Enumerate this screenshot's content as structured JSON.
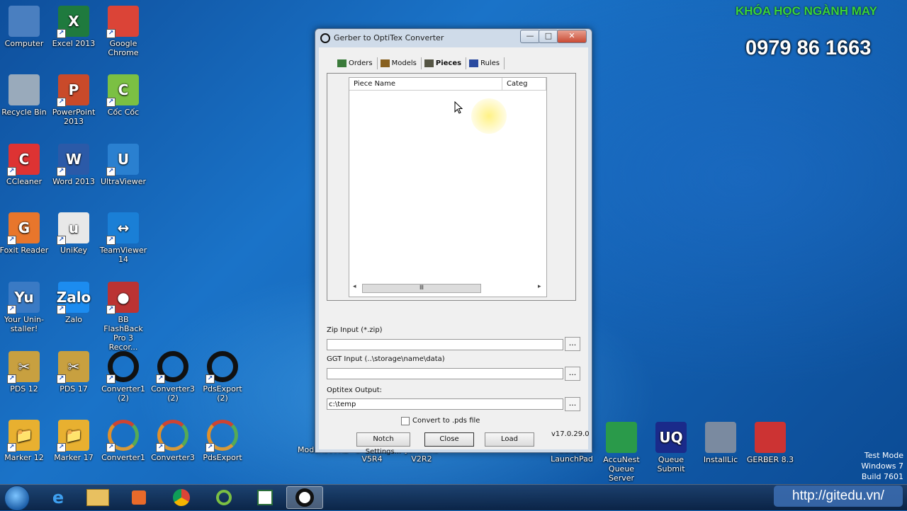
{
  "desktop_icons": [
    {
      "label": "Computer",
      "color": "#4a7fc0",
      "glyph": "monitor-icon"
    },
    {
      "label": "Excel 2013",
      "color": "#1f7a3e",
      "glyph": "X"
    },
    {
      "label": "Google Chrome",
      "color": "#db4437",
      "glyph": "chrome-icon"
    },
    {
      "label": "Recycle Bin",
      "color": "#9ab",
      "glyph": "bin-icon"
    },
    {
      "label": "PowerPoint 2013",
      "color": "#c94a2a",
      "glyph": "P"
    },
    {
      "label": "Cốc Cốc",
      "color": "#7bc043",
      "glyph": "C"
    },
    {
      "label": "CCleaner",
      "color": "#d33",
      "glyph": "C"
    },
    {
      "label": "Word 2013",
      "color": "#2b5aa8",
      "glyph": "W"
    },
    {
      "label": "UltraViewer",
      "color": "#2a80d0",
      "glyph": "U"
    },
    {
      "label": "Foxit Reader",
      "color": "#e8762c",
      "glyph": "G"
    },
    {
      "label": "UniKey",
      "color": "#e8e8e8",
      "glyph": "u"
    },
    {
      "label": "TeamViewer 14",
      "color": "#1a7fd6",
      "glyph": "↔"
    },
    {
      "label": "Your Unin-staller!",
      "color": "#3a7ac4",
      "glyph": "Yu"
    },
    {
      "label": "Zalo",
      "color": "#1c8cf0",
      "glyph": "Zalo"
    },
    {
      "label": "BB FlashBack Pro 3 Recor...",
      "color": "#b33",
      "glyph": "●"
    },
    {
      "label": "PDS 12",
      "color": "#c8a040",
      "glyph": "✂"
    },
    {
      "label": "PDS 17",
      "color": "#c8a040",
      "glyph": "✂"
    },
    {
      "label": "Converter1 (2)",
      "color": "ring",
      "glyph": ""
    },
    {
      "label": "Converter3 (2)",
      "color": "ring",
      "glyph": ""
    },
    {
      "label": "PdsExport (2)",
      "color": "ring",
      "glyph": ""
    },
    {
      "label": "Marker 12",
      "color": "#e8b030",
      "glyph": "📁"
    },
    {
      "label": "Marker 17",
      "color": "#e8b030",
      "glyph": "📁"
    },
    {
      "label": "Converter1",
      "color": "ringc",
      "glyph": ""
    },
    {
      "label": "Converter3",
      "color": "ringc",
      "glyph": ""
    },
    {
      "label": "PdsExport",
      "color": "ringc",
      "glyph": ""
    }
  ],
  "right_icons": [
    {
      "label": "ModarisV7R2"
    },
    {
      "label": "Diamino V5R4"
    },
    {
      "label": "JustPrint V2R2"
    },
    {
      "label": "Gerber LaunchPad"
    },
    {
      "label": "AccuNest Queue Server"
    },
    {
      "label": "Queue Submit"
    },
    {
      "label": "InstallLic"
    },
    {
      "label": "GERBER 8.3"
    }
  ],
  "window": {
    "title": "Gerber to OptiTex Converter",
    "minimize": "—",
    "maximize": "□",
    "close": "✕",
    "tabs": [
      {
        "label": "Orders",
        "active": false
      },
      {
        "label": "Models",
        "active": false
      },
      {
        "label": "Pieces",
        "active": true
      },
      {
        "label": "Rules",
        "active": false
      }
    ],
    "grid_columns": [
      "Piece Name",
      "Categ"
    ],
    "scroll_left": "◂",
    "scroll_right": "▸",
    "scroll_thumb": "Ⅲ",
    "zip_label": "Zip Input (*.zip)",
    "zip_value": "",
    "ggt_label": "GGT Input (..\\storage\\name\\data)",
    "ggt_value": "",
    "output_label": "Optitex Output:",
    "output_value": "c:\\temp",
    "browse": "...",
    "convert_label": "Convert to .pds file",
    "convert_checked": false,
    "notch_button": "Notch Settings...",
    "close_button": "Close",
    "load_button": "Load",
    "version": "v17.0.29.0"
  },
  "overlay": {
    "course_title": "KHÓA HỌC NGÀNH MAY",
    "phone": "0979 86 1663",
    "site": "http://gitedu.vn/"
  },
  "watermark": {
    "line1": "Test Mode",
    "line2": "Windows 7",
    "line3": "Build 7601"
  },
  "taskbar": {
    "items": [
      "ie-icon",
      "explorer-icon",
      "media-player-icon",
      "chrome-icon",
      "coccoc-icon",
      "zalo-icon",
      "converter-icon"
    ]
  }
}
